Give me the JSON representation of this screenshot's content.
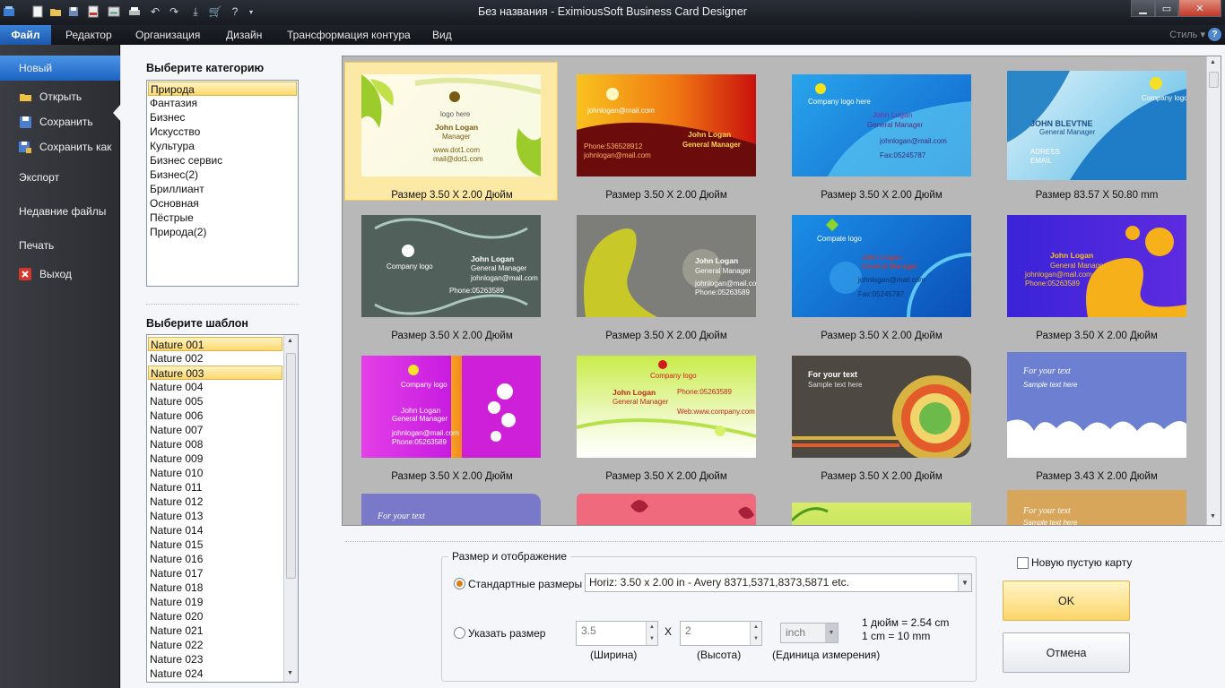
{
  "window": {
    "title": "Без названия - EximiousSoft Business Card Designer"
  },
  "ribbon": {
    "tabs": [
      "Файл",
      "Редактор",
      "Организация",
      "Дизайн",
      "Трансформация контура",
      "Вид"
    ],
    "style_label": "Стиль"
  },
  "file_menu": {
    "items": [
      {
        "label": "Новый",
        "icon": "new-icon"
      },
      {
        "label": "Открыть",
        "icon": "folder-open-icon"
      },
      {
        "label": "Сохранить",
        "icon": "save-icon"
      },
      {
        "label": "Сохранить как",
        "icon": "save-as-icon"
      },
      {
        "label": "Экспорт",
        "icon": ""
      },
      {
        "label": "Недавние файлы",
        "icon": ""
      },
      {
        "label": "Печать",
        "icon": ""
      },
      {
        "label": "Выход",
        "icon": "exit-icon"
      }
    ]
  },
  "categories": {
    "heading": "Выберите категорию",
    "items": [
      "Природа",
      "Фантазия",
      "Бизнес",
      "Искусство",
      "Культура",
      "Бизнес сервис",
      "Бизнес(2)",
      "Бриллиант",
      "Основная",
      "Пёстрые",
      "Природа(2)"
    ],
    "selected": "Природа"
  },
  "templates": {
    "heading": "Выберите шаблон",
    "items": [
      "Nature 001",
      "Nature 002",
      "Nature 003",
      "Nature 004",
      "Nature 005",
      "Nature 006",
      "Nature 007",
      "Nature 008",
      "Nature 009",
      "Nature 010",
      "Nature 011",
      "Nature 012",
      "Nature 013",
      "Nature 014",
      "Nature 015",
      "Nature 016",
      "Nature 017",
      "Nature 018",
      "Nature 019",
      "Nature 020",
      "Nature 021",
      "Nature 022",
      "Nature 023",
      "Nature 024"
    ],
    "highlighted": [
      "Nature 001",
      "Nature 003"
    ]
  },
  "gallery": {
    "cards": [
      {
        "caption": "Размер 3.50 X 2.00 Дюйм",
        "name": "John Logan",
        "role": "Manager",
        "logo": "logo here",
        "extra": "www.dot1.com",
        "extra2": "mail@dot1.com"
      },
      {
        "caption": "Размер 3.50 X 2.00 Дюйм",
        "name": "John Logan",
        "role": "General Manager",
        "logo": "johnlogan@mail.com",
        "extra": "Phone:536528912",
        "extra2": "johnlogan@mail.com"
      },
      {
        "caption": "Размер 3.50 X 2.00 Дюйм",
        "name": "John Logan",
        "role": "General Manager",
        "logo": "Company logo here",
        "extra": "johnlogan@mail.com",
        "extra2": "Fax:05245787"
      },
      {
        "caption": "Размер 83.57 X 50.80 mm",
        "name": "JOHN BLEVTNE",
        "role": "General Manager",
        "logo": "Company logo here",
        "extra": "ADRESS",
        "extra2": "EMAIL"
      },
      {
        "caption": "Размер 3.50 X 2.00 Дюйм",
        "name": "John Logan",
        "role": "General Manager",
        "logo": "Company logo",
        "extra": "johnlogan@mail.com",
        "extra2": "Phone:05263589"
      },
      {
        "caption": "Размер 3.50 X 2.00 Дюйм",
        "name": "John Logan",
        "role": "General Manager",
        "logo": "",
        "extra": "johnlogan@mail.com",
        "extra2": "Phone:05263589"
      },
      {
        "caption": "Размер 3.50 X 2.00 Дюйм",
        "name": "John Logan",
        "role": "General Manager",
        "logo": "Compate logo",
        "extra": "johnlogan@mail.com",
        "extra2": "Fax:05245787"
      },
      {
        "caption": "Размер 3.50 X 2.00 Дюйм",
        "name": "John Logan",
        "role": "General Manager",
        "logo": "",
        "extra": "johnlogan@mail.com",
        "extra2": "Phone:05263589"
      },
      {
        "caption": "Размер 3.50 X 2.00 Дюйм",
        "name": "John Logan",
        "role": "General Manager",
        "logo": "Company logo",
        "extra": "johnlogan@mail.com",
        "extra2": "Phone:05263589"
      },
      {
        "caption": "Размер 3.50 X 2.00 Дюйм",
        "name": "John Logan",
        "role": "General Manager",
        "logo": "Company logo",
        "extra": "Phone:05263589",
        "extra2": "Web:www.company.com"
      },
      {
        "caption": "Размер 3.50 X 2.00 Дюйм",
        "name": "For your text",
        "role": "Sample text here",
        "logo": "",
        "extra": "",
        "extra2": ""
      },
      {
        "caption": "Размер 3.43 X 2.00 Дюйм",
        "name": "For your text",
        "role": "Sample text here",
        "logo": "",
        "extra": "",
        "extra2": ""
      },
      {
        "caption": "",
        "name": "For your text",
        "role": "",
        "logo": "",
        "extra": "",
        "extra2": ""
      },
      {
        "caption": "",
        "name": "",
        "role": "",
        "logo": "",
        "extra": "",
        "extra2": ""
      },
      {
        "caption": "",
        "name": "",
        "role": "",
        "logo": "",
        "extra": "",
        "extra2": ""
      },
      {
        "caption": "",
        "name": "For your text",
        "role": "Sample text here",
        "logo": "",
        "extra": "",
        "extra2": ""
      }
    ]
  },
  "size_group": {
    "title": "Размер и отображение",
    "standard_label": "Стандартные размеры",
    "standard_value": "Horiz: 3.50 x 2.00 in - Avery 8371,5371,8373,5871 etc.",
    "custom_label": "Указать размер",
    "width_value": "3.5",
    "height_value": "2",
    "times": "X",
    "unit_value": "inch",
    "width_caption": "(Ширина)",
    "height_caption": "(Высота)",
    "unit_caption": "(Единица измерения)",
    "conv1": "1 дюйм = 2.54 cm",
    "conv2": "1 cm = 10 mm"
  },
  "dialog": {
    "new_blank_label": "Новую пустую карту",
    "ok_label": "OK",
    "cancel_label": "Отмена"
  },
  "colors": {
    "accent": "#1d63c2",
    "selection": "#fcd96c"
  }
}
